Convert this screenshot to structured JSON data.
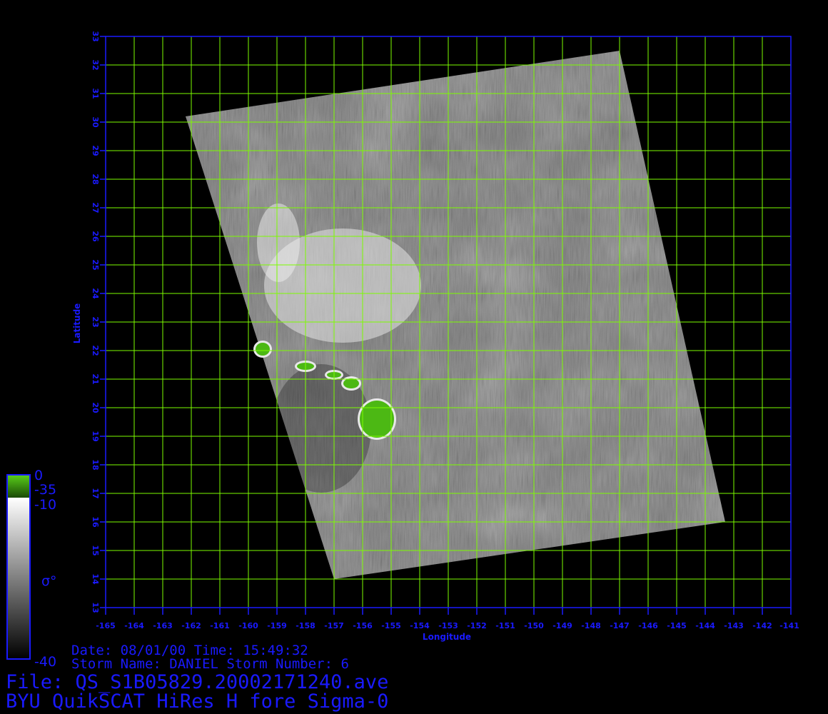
{
  "map": {
    "x_axis_title": "Longitude",
    "y_axis_title": "Latitude",
    "lon_ticks": [
      "-165",
      "-164",
      "-163",
      "-162",
      "-161",
      "-160",
      "-159",
      "-158",
      "-157",
      "-156",
      "-155",
      "-154",
      "-153",
      "-152",
      "-151",
      "-150",
      "-149",
      "-148",
      "-147",
      "-146",
      "-145",
      "-144",
      "-143",
      "-142",
      "-141"
    ],
    "lat_ticks": [
      "13",
      "14",
      "15",
      "16",
      "17",
      "18",
      "19",
      "20",
      "21",
      "22",
      "23",
      "24",
      "25",
      "26",
      "27",
      "28",
      "29",
      "30",
      "31",
      "32",
      "33"
    ],
    "lon_range": [
      -165,
      -141
    ],
    "lat_range": [
      13,
      33
    ],
    "swath_corners_lonlat": [
      [
        -162.2,
        30.2
      ],
      [
        -147.0,
        32.5
      ],
      [
        -143.3,
        16.0
      ],
      [
        -157.0,
        14.0
      ]
    ],
    "islands": [
      {
        "name": "Kauai",
        "lon": -159.5,
        "lat": 22.05
      },
      {
        "name": "Oahu",
        "lon": -158.0,
        "lat": 21.45
      },
      {
        "name": "Molokai",
        "lon": -157.0,
        "lat": 21.15
      },
      {
        "name": "Maui",
        "lon": -156.4,
        "lat": 20.85
      },
      {
        "name": "Hawaii",
        "lon": -155.5,
        "lat": 19.6
      }
    ],
    "grid_color": "#7cfc00",
    "axis_color": "#1a1aff",
    "land_color": "#4cb814"
  },
  "colorbar": {
    "land_labels": [
      "0",
      "-35"
    ],
    "top_label": "-10",
    "bottom_label": "-40",
    "symbol": "σ°"
  },
  "info": {
    "date_line": "Date: 08/01/00  Time: 15:49:32",
    "storm_line": "Storm Name: DANIEL  Storm Number: 6",
    "file_line": "File: QS_S1B05829.20002171240.ave",
    "product_line": "BYU QuikSCAT HiRes H fore Sigma-0"
  }
}
